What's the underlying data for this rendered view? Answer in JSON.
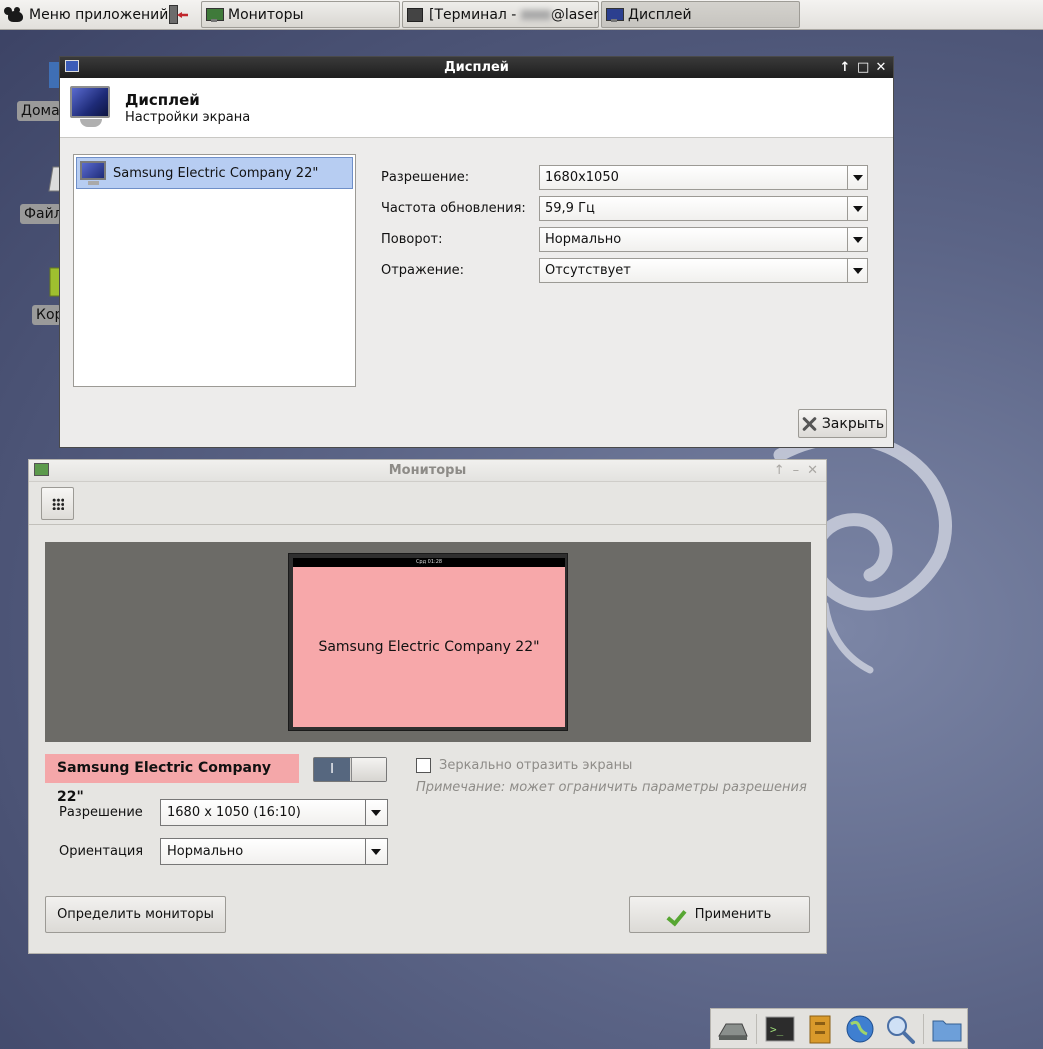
{
  "panel": {
    "app_menu_label": "Меню приложений",
    "tasks": [
      {
        "label": "Мониторы"
      },
      {
        "label_prefix": "[Терминал - ",
        "label_suffix": "@laser..."
      },
      {
        "label": "Дисплей"
      }
    ]
  },
  "desktop": {
    "icons": [
      {
        "label": "Дома"
      },
      {
        "label": "Файл"
      },
      {
        "label": "Кор"
      }
    ]
  },
  "display_window": {
    "title": "Дисплей",
    "controls": [
      "↑",
      "□",
      "✕"
    ],
    "header_title": "Дисплей",
    "header_subtitle": "Настройки экрана",
    "monitors": [
      "Samsung Electric Company 22\""
    ],
    "fields": [
      {
        "label": "Разрешение:",
        "value": "1680x1050"
      },
      {
        "label": "Частота обновления:",
        "value": "59,9 Гц"
      },
      {
        "label": "Поворот:",
        "value": "Нормально"
      },
      {
        "label": "Отражение:",
        "value": "Отсутствует"
      }
    ],
    "close_label": "Закрыть"
  },
  "monitors_window": {
    "title": "Мониторы",
    "controls": [
      "↑",
      "–",
      "✕"
    ],
    "preview": {
      "clock": "Срд 01:28",
      "monitor_label": "Samsung Electric Company 22\""
    },
    "monitor_name": "Samsung Electric Company 22\"",
    "toggle_on_label": "I",
    "mirror_label": "Зеркально отразить экраны",
    "note": "Примечание: может ограничить параметры разрешения",
    "resolution_label": "Разрешение",
    "resolution_value": "1680 x 1050 (16:10)",
    "orientation_label": "Ориентация",
    "orientation_value": "Нормально",
    "detect_label": "Определить мониторы",
    "apply_label": "Применить"
  },
  "colors": {
    "monitor_preview": "#f7a8aa",
    "titlebar_active": "#1e1e1e",
    "apply_check": "#57a632"
  }
}
